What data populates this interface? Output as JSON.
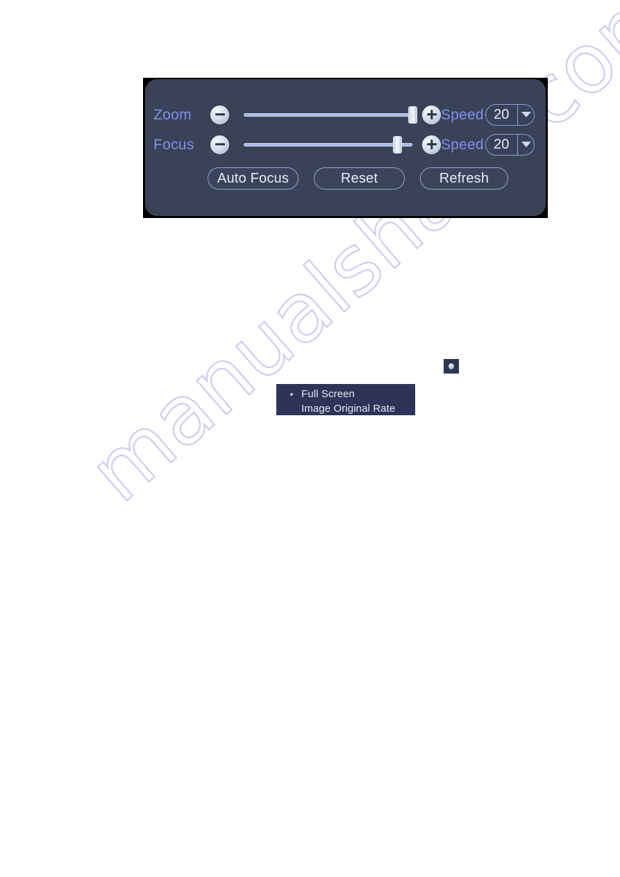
{
  "panel": {
    "name": "ptz-zoom-focus-panel",
    "rows": [
      {
        "id": "zoom",
        "label": "Zoom",
        "decrease_icon": "minus-icon",
        "increase_icon": "plus-icon",
        "slider_value_percent": 100,
        "speed_label": "Speed",
        "speed_value": "20",
        "dropdown_icon": "chevron-down-icon"
      },
      {
        "id": "focus",
        "label": "Focus",
        "decrease_icon": "minus-icon",
        "increase_icon": "plus-icon",
        "slider_value_percent": 91,
        "speed_label": "Speed",
        "speed_value": "20",
        "dropdown_icon": "chevron-down-icon"
      }
    ],
    "actions": [
      {
        "id": "auto-focus",
        "label": "Auto Focus"
      },
      {
        "id": "reset",
        "label": "Reset"
      },
      {
        "id": "refresh",
        "label": "Refresh"
      }
    ],
    "colors": {
      "panel_background": "#3a4257",
      "label_text": "#7f8ff0",
      "button_text": "#e8edf7",
      "border": "#8fa0d8",
      "backdrop": "#000000"
    }
  },
  "toolbar_icon": {
    "name": "record-dot-icon",
    "background": "#2e3553",
    "dot_color": "#d6dae6"
  },
  "context_menu": {
    "name": "display-mode-menu",
    "background": "#2e3457",
    "items": [
      {
        "label": "Full Screen",
        "selected": true
      },
      {
        "label": "Image Original Rate",
        "selected": false
      }
    ]
  },
  "watermark": {
    "text": "manualshare.com",
    "color": "#ccccf2",
    "rotation_degrees": -41
  }
}
